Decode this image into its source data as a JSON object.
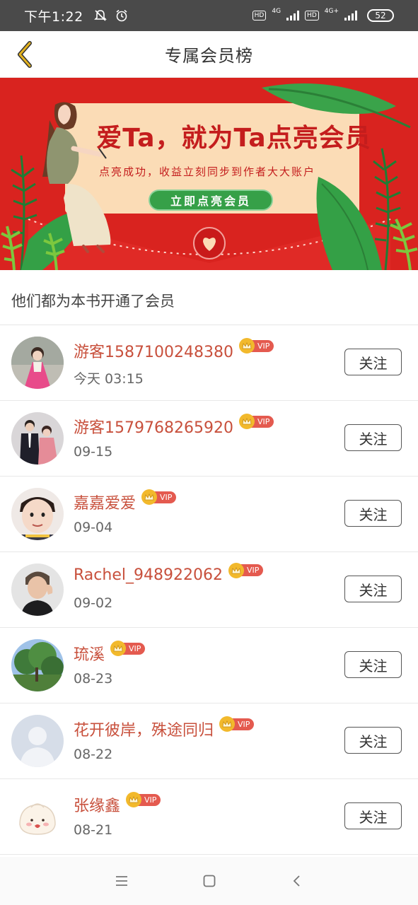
{
  "status_bar": {
    "time": "下午1:22",
    "hd1": "HD",
    "net1": "4G",
    "hd2": "HD",
    "net2": "4G+",
    "battery": "52"
  },
  "header": {
    "title": "专属会员榜",
    "back_icon": "chevron-left-icon"
  },
  "banner": {
    "headline": "爱Ta，就为Ta点亮会员",
    "subtitle": "点亮成功，收益立刻同步到作者大大账户",
    "cta": "立即点亮会员",
    "colors": {
      "background": "#d9231f",
      "card": "#fbdcb6",
      "cta": "#36a048"
    }
  },
  "section": {
    "title": "他们都为本书开通了会员"
  },
  "members": [
    {
      "name": "游客1587100248380",
      "badge": "VIP",
      "date": "今天 03:15",
      "follow": "关注"
    },
    {
      "name": "游客1579768265920",
      "badge": "VIP",
      "date": "09-15",
      "follow": "关注"
    },
    {
      "name": "嘉嘉爱爱",
      "badge": "VIP",
      "date": "09-04",
      "follow": "关注"
    },
    {
      "name": "Rachel_948922062",
      "badge": "VIP",
      "date": "09-02",
      "follow": "关注"
    },
    {
      "name": "琉溪",
      "badge": "VIP",
      "date": "08-23",
      "follow": "关注"
    },
    {
      "name": "花开彼岸，殊途同归",
      "badge": "VIP",
      "date": "08-22",
      "follow": "关注"
    },
    {
      "name": "张缘鑫",
      "badge": "VIP",
      "date": "08-21",
      "follow": "关注"
    }
  ],
  "nav": {
    "menu_icon": "menu-icon",
    "home_icon": "home-icon",
    "back_icon": "back-icon"
  },
  "colors": {
    "name": "#c8503c",
    "vip": "#e45a4f",
    "crown": "#f2b92c",
    "back_arrow": "#e3b21f"
  }
}
